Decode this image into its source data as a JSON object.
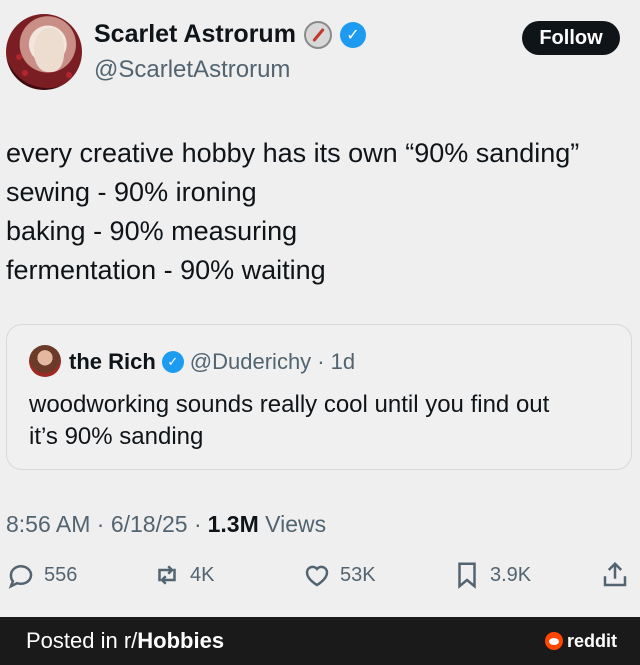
{
  "tweet": {
    "author_name": "Scarlet Astrorum",
    "author_handle": "@ScarletAstrorum",
    "follow_label": "Follow",
    "lines": [
      "every creative hobby has its own “90% sanding”",
      "sewing - 90% ironing",
      "baking - 90% measuring",
      "fermentation - 90% waiting"
    ],
    "timestamp": "8:56 AM · 6/18/25 ·",
    "views_count": "1.3M",
    "views_label": "Views"
  },
  "quote": {
    "name": "the Rich",
    "handle": "@Duderichy",
    "age": "· 1d",
    "text_line1": "woodworking sounds really cool until you find out",
    "text_line2": "it’s 90% sanding"
  },
  "actions": {
    "replies": "556",
    "reposts": "4K",
    "likes": "53K",
    "bookmarks": "3.9K"
  },
  "icons": [
    "compass-icon",
    "verified-icon",
    "reply-icon",
    "repost-icon",
    "like-icon",
    "bookmark-icon",
    "share-icon",
    "reddit-icon"
  ],
  "footer": {
    "prefix": "Posted in r/",
    "subreddit": "Hobbies",
    "brand": "reddit"
  },
  "colors": {
    "verified": "#1d9bf0",
    "reddit": "#ff4500",
    "footer_bg": "#1a1a1b"
  }
}
